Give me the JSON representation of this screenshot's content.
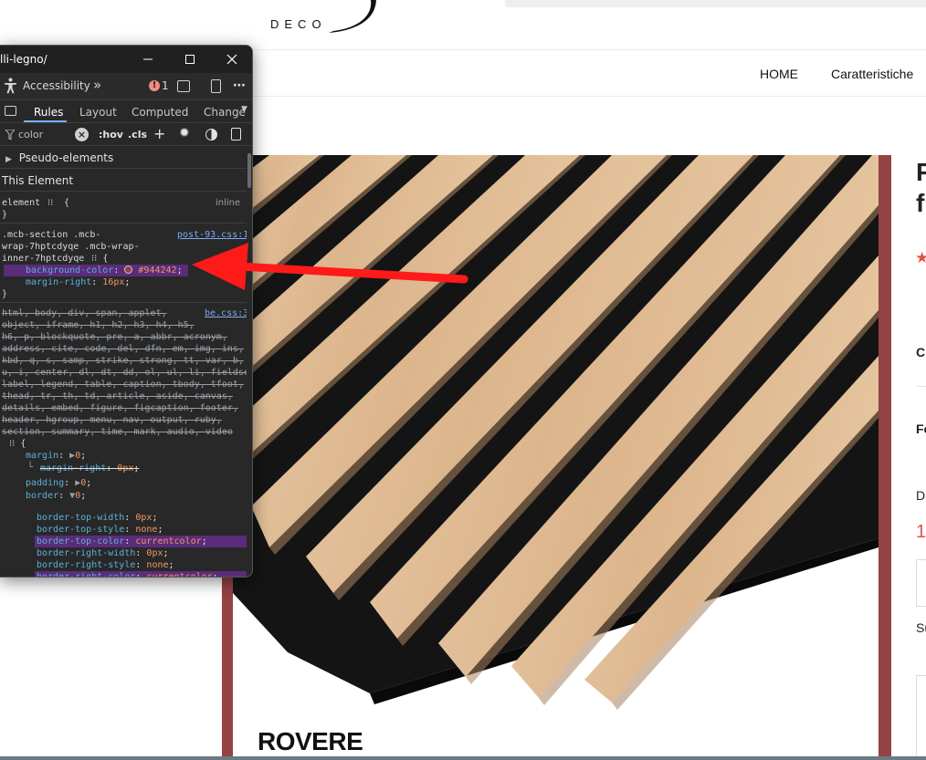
{
  "website": {
    "logo_text": "DECO",
    "nav": {
      "home": "HOME",
      "caratteristiche": "Caratteristiche"
    },
    "product_heading": "ROVERE",
    "right_column": {
      "title_line1": "P",
      "title_line2": "f",
      "star": "★",
      "label_c": "C",
      "label_fo": "Fo",
      "label_d": "D",
      "price_start": "1",
      "label_su": "Su"
    },
    "section_color": "#944242"
  },
  "devtools": {
    "window_title": "lli-legno/",
    "toolbar": {
      "accessibility_label": "Accessibility",
      "issues_count": "1"
    },
    "tabs": [
      "Rules",
      "Layout",
      "Computed",
      "Change"
    ],
    "active_tab": "Rules",
    "filter": {
      "placeholder": "color",
      "hov_label": ":hov",
      "cls_label": ".cls"
    },
    "pseudo_elements_label": "Pseudo-elements",
    "this_element_label": "This Element",
    "element_rule": {
      "selector": "element",
      "open": "{",
      "source": "inline",
      "close": "}"
    },
    "mcb_rule": {
      "selector_line1": ".mcb-section .mcb-",
      "selector_line2": "wrap-7hptcdyqe .mcb-wrap-",
      "selector_line3": "inner-7hptcdyqe",
      "source": "post-93.css:1",
      "bg_prop": "background-color",
      "bg_value": "#944242",
      "mr_prop": "margin-right",
      "mr_value": "16px"
    },
    "reset_rule": {
      "source": "be.css:3",
      "selector_lines": [
        "html, body, div, span, applet,",
        "object, iframe, h1, h2, h3, h4, h5,",
        "h6, p, blockquote, pre, a, abbr, acronym,",
        "address, cite, code, del, dfn, em, img, ins,",
        "kbd, q, s, samp, strike, strong, tt, var, b,",
        "u, i, center, dl, dt, dd, ol, ul, li, fieldset, form,",
        "label, legend, table, caption, tbody, tfoot,",
        "thead, tr, th, td, article, aside, canvas,",
        "details, embed, figure, figcaption, footer,",
        "header, hgroup, menu, nav, output, ruby,",
        "section, summary, time, mark, audio, video"
      ],
      "margin_prop": "margin",
      "margin_value": "0",
      "margin_right_prop": "margin-right",
      "margin_right_value": "0px",
      "padding_prop": "padding",
      "padding_value": "0",
      "border_prop": "border",
      "border_value": "0",
      "longhands": [
        {
          "prop": "border-top-width",
          "value": "0px",
          "highlight": false
        },
        {
          "prop": "border-top-style",
          "value": "none",
          "highlight": false
        },
        {
          "prop": "border-top-color",
          "value": "currentcolor",
          "highlight": true
        },
        {
          "prop": "border-right-width",
          "value": "0px",
          "highlight": false
        },
        {
          "prop": "border-right-style",
          "value": "none",
          "highlight": false
        },
        {
          "prop": "border-right-color",
          "value": "currentcolor",
          "highlight": true
        }
      ]
    }
  },
  "colors": {
    "arrow": "#ff1a1a",
    "devtools_bg": "#282828",
    "highlight": "#5a2c7a"
  }
}
